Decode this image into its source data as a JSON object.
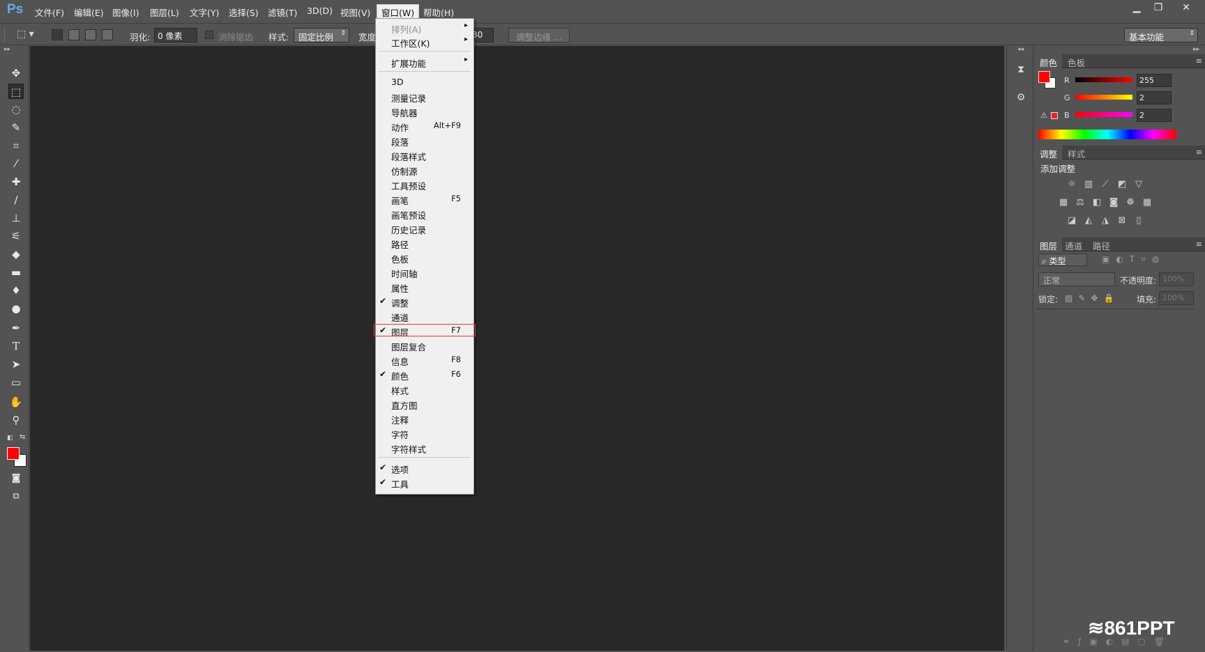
{
  "app": {
    "logo": "Ps"
  },
  "menubar": {
    "items": [
      "文件(F)",
      "编辑(E)",
      "图像(I)",
      "图层(L)",
      "文字(Y)",
      "选择(S)",
      "滤镜(T)",
      "3D(D)",
      "视图(V)",
      "窗口(W)",
      "帮助(H)"
    ],
    "window_controls": {
      "minimize": "▁",
      "maximize": "❐",
      "close": "✕"
    }
  },
  "options": {
    "feather_label": "羽化:",
    "feather_value": "0 像素",
    "antialias_label": "消除锯齿",
    "style_label": "样式:",
    "style_value": "固定比例",
    "width_label": "宽度",
    "height_partial": "30",
    "refine_edge": "调整边缘 ...",
    "workspace": "基本功能"
  },
  "window_menu": {
    "items": [
      {
        "label": "排列(A)",
        "submenu": true,
        "disabled": true
      },
      {
        "label": "工作区(K)",
        "submenu": true
      },
      {
        "label": "扩展功能",
        "submenu": true
      },
      {
        "label": "3D"
      },
      {
        "label": "测量记录"
      },
      {
        "label": "导航器"
      },
      {
        "label": "动作",
        "shortcut": "Alt+F9"
      },
      {
        "label": "段落"
      },
      {
        "label": "段落样式"
      },
      {
        "label": "仿制源"
      },
      {
        "label": "工具预设"
      },
      {
        "label": "画笔",
        "shortcut": "F5"
      },
      {
        "label": "画笔预设"
      },
      {
        "label": "历史记录"
      },
      {
        "label": "路径"
      },
      {
        "label": "色板"
      },
      {
        "label": "时间轴"
      },
      {
        "label": "属性"
      },
      {
        "label": "调整",
        "checked": true
      },
      {
        "label": "通道"
      },
      {
        "label": "图层",
        "shortcut": "F7",
        "checked": true,
        "highlighted": true
      },
      {
        "label": "图层复合"
      },
      {
        "label": "信息",
        "shortcut": "F8"
      },
      {
        "label": "颜色",
        "shortcut": "F6",
        "checked": true
      },
      {
        "label": "样式"
      },
      {
        "label": "直方图"
      },
      {
        "label": "注释"
      },
      {
        "label": "字符"
      },
      {
        "label": "字符样式"
      },
      {
        "label": "选项",
        "checked": true
      },
      {
        "label": "工具",
        "checked": true
      }
    ]
  },
  "color_panel": {
    "tabs": [
      "颜色",
      "色板"
    ],
    "r_label": "R",
    "g_label": "G",
    "b_label": "B",
    "r_value": "255",
    "g_value": "2",
    "b_value": "2",
    "foreground": "#ff0202",
    "background": "#ffffff"
  },
  "adjust_panel": {
    "tabs": [
      "调整",
      "样式"
    ],
    "title": "添加调整",
    "icons": [
      "brightness-icon",
      "levels-icon",
      "curves-icon",
      "exposure-icon",
      "vibrance-icon",
      "hue-saturation-icon",
      "color-balance-icon",
      "black-white-icon",
      "photo-filter-icon",
      "channel-mixer-icon",
      "color-lookup-icon",
      "invert-icon",
      "posterize-icon",
      "threshold-icon",
      "gradient-map-icon",
      "selective-color-icon"
    ]
  },
  "layers_panel": {
    "tabs": [
      "图层",
      "通道",
      "路径"
    ],
    "filter_label": "类型",
    "blend_mode": "正常",
    "opacity_label": "不透明度:",
    "opacity_value": "100%",
    "lock_label": "锁定:",
    "fill_label": "填充:",
    "fill_value": "100%"
  },
  "watermark": "861PPT"
}
